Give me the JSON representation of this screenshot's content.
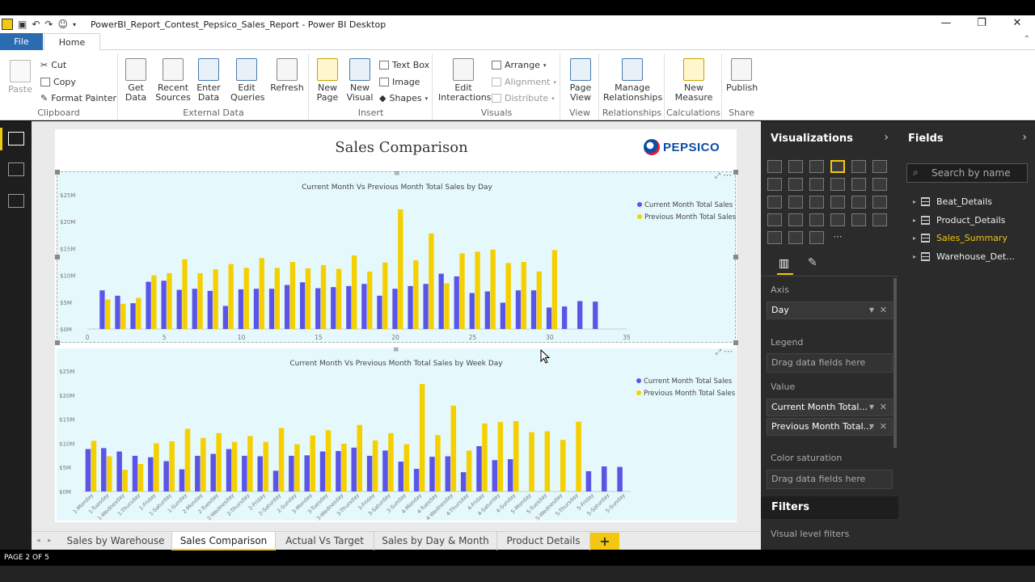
{
  "window": {
    "title": "PowerBI_Report_Contest_Pepsico_Sales_Report - Power BI Desktop"
  },
  "tabs": {
    "file": "File",
    "home": "Home"
  },
  "ribbon": {
    "clipboard": {
      "label": "Clipboard",
      "paste": "Paste",
      "cut": "Cut",
      "copy": "Copy",
      "format_painter": "Format Painter"
    },
    "external_data": {
      "label": "External Data",
      "get_data": "Get\nData",
      "recent_sources": "Recent\nSources",
      "enter_data": "Enter\nData",
      "edit_queries": "Edit\nQueries",
      "refresh": "Refresh"
    },
    "insert": {
      "label": "Insert",
      "new_page": "New\nPage",
      "new_visual": "New\nVisual",
      "text_box": "Text Box",
      "image": "Image",
      "shapes": "Shapes"
    },
    "visuals": {
      "label": "Visuals",
      "edit_interactions": "Edit\nInteractions",
      "arrange": "Arrange",
      "alignment": "Alignment",
      "distribute": "Distribute"
    },
    "view": {
      "label": "View",
      "page_view": "Page\nView"
    },
    "relationships": {
      "label": "Relationships",
      "manage": "Manage\nRelationships"
    },
    "calculations": {
      "label": "Calculations",
      "new_measure": "New\nMeasure"
    },
    "share": {
      "label": "Share",
      "publish": "Publish"
    }
  },
  "report": {
    "title": "Sales Comparison",
    "logo_text": "PEPSICO"
  },
  "colors": {
    "current": "#5b54e6",
    "previous": "#f5d000",
    "accent": "#f2c811"
  },
  "chart_data": [
    {
      "type": "bar",
      "title": "Current Month Vs Previous Month Total Sales by Day",
      "legend_position": "top-right",
      "x": [
        1,
        2,
        3,
        4,
        5,
        6,
        7,
        8,
        9,
        10,
        11,
        12,
        13,
        14,
        15,
        16,
        17,
        18,
        19,
        20,
        21,
        22,
        23,
        24,
        25,
        26,
        27,
        28,
        29,
        30,
        31
      ],
      "xlim": [
        0,
        35
      ],
      "xticks": [
        0,
        5,
        10,
        15,
        20,
        25,
        30,
        35
      ],
      "ylim": [
        0,
        25
      ],
      "yticks": [
        "$0M",
        "$5M",
        "$10M",
        "$15M",
        "$20M",
        "$25M"
      ],
      "grid": false,
      "series": [
        {
          "name": "Current Month Total Sales",
          "values": [
            7.2,
            6.2,
            4.8,
            8.8,
            9.0,
            7.3,
            7.5,
            7.1,
            4.3,
            7.4,
            7.5,
            7.5,
            8.2,
            8.7,
            7.6,
            7.8,
            8.0,
            8.4,
            6.2,
            7.5,
            8.0,
            8.4,
            10.3,
            9.8,
            6.7,
            7.0,
            4.9,
            7.2,
            7.2,
            4.0,
            4.2,
            5.2,
            5.1
          ]
        },
        {
          "name": "Previous Month Total Sales",
          "values": [
            5.5,
            4.7,
            5.8,
            10.0,
            10.4,
            13.0,
            10.4,
            11.1,
            12.1,
            11.4,
            13.2,
            11.4,
            12.5,
            11.3,
            11.9,
            11.2,
            13.7,
            10.7,
            12.4,
            22.3,
            12.8,
            17.8,
            8.5,
            14.1,
            14.4,
            14.8,
            12.3,
            12.5,
            10.7,
            14.7
          ]
        }
      ]
    },
    {
      "type": "bar",
      "title": "Current Month Vs Previous Month Total Sales by Week Day",
      "legend_position": "top-right",
      "categories": [
        "1-Monday",
        "1-Tuesday",
        "1-Wednesday",
        "1-Thursday",
        "1-Friday",
        "1-Saturday",
        "1-Sunday",
        "2-Monday",
        "2-Tuesday",
        "2-Wednesday",
        "2-Thursday",
        "2-Friday",
        "2-Saturday",
        "2-Sunday",
        "3-Monday",
        "3-Tuesday",
        "3-Wednesday",
        "3-Thursday",
        "3-Friday",
        "3-Saturday",
        "3-Sunday",
        "4-Monday",
        "4-Tuesday",
        "4-Wednesday",
        "4-Thursday",
        "4-Friday",
        "4-Saturday",
        "4-Sunday",
        "5-Monday",
        "5-Tuesday",
        "5-Wednesday",
        "5-Thursday",
        "5-Friday",
        "5-Saturday",
        "5-Sunday"
      ],
      "ylim": [
        0,
        25
      ],
      "yticks": [
        "$0M",
        "$5M",
        "$10M",
        "$15M",
        "$20M",
        "$25M"
      ],
      "grid": false,
      "series": [
        {
          "name": "Current Month Total Sales",
          "values": [
            8.8,
            9.0,
            8.3,
            7.4,
            7.1,
            6.3,
            4.6,
            7.4,
            7.8,
            8.8,
            7.4,
            7.3,
            4.3,
            7.4,
            7.5,
            8.3,
            8.4,
            9.1,
            7.4,
            8.5,
            6.2,
            4.7,
            7.2,
            7.3,
            4.0,
            9.4,
            6.5,
            6.7,
            0,
            0,
            0,
            0,
            4.2,
            5.2,
            5.1
          ]
        },
        {
          "name": "Previous Month Total Sales",
          "values": [
            10.5,
            7.3,
            4.5,
            5.7,
            10.0,
            10.4,
            13.0,
            11.1,
            12.1,
            10.3,
            11.5,
            10.3,
            13.2,
            9.8,
            11.6,
            12.7,
            9.9,
            13.8,
            10.6,
            12.1,
            9.8,
            22.3,
            11.7,
            17.8,
            8.5,
            14.1,
            14.4,
            14.6,
            12.3,
            12.5,
            10.7,
            14.5,
            0,
            0,
            0
          ]
        }
      ]
    }
  ],
  "page_tabs": [
    "Sales by Warehouse",
    "Sales Comparison",
    "Actual Vs Target",
    "Sales by Day & Month",
    "Product Details"
  ],
  "active_tab": "Sales Comparison",
  "status": {
    "page": "PAGE 2 OF 5"
  },
  "visualizations": {
    "title": "Visualizations",
    "axis_label": "Axis",
    "axis_value": "Day",
    "legend_label": "Legend",
    "legend_placeholder": "Drag data fields here",
    "value_label": "Value",
    "value1": "Current Month Total...",
    "value2": "Previous Month Total...",
    "saturation_label": "Color saturation",
    "saturation_placeholder": "Drag data fields here",
    "filters": "Filters",
    "visual_filters": "Visual level filters"
  },
  "fields": {
    "title": "Fields",
    "search_placeholder": "Search by name",
    "tables": [
      "Beat_Details",
      "Product_Details",
      "Sales_Summary",
      "Warehouse_Det..."
    ]
  }
}
